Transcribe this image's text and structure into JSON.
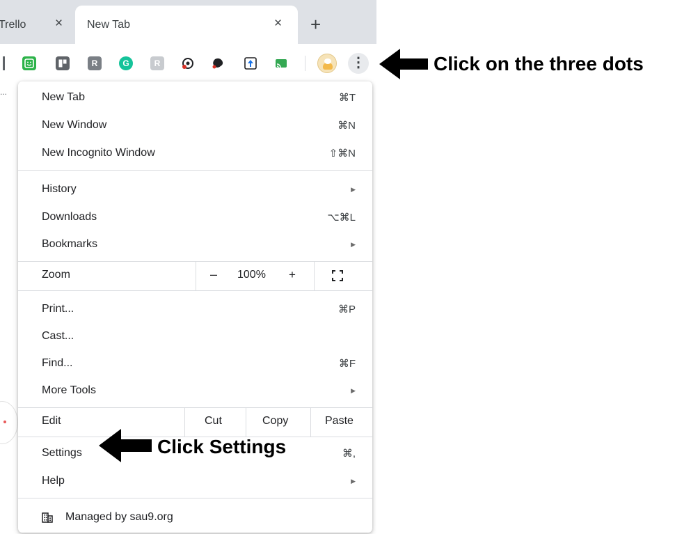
{
  "tabs": [
    {
      "title": "Trello",
      "close": "×"
    },
    {
      "title": "New Tab",
      "close": "×"
    }
  ],
  "new_tab_symbol": "+",
  "bookmark_stub": "...",
  "extensions": [
    {
      "icon": "smiley-extension-icon",
      "color": "#2db34a",
      "glyph": ""
    },
    {
      "icon": "trello-extension-icon",
      "color": "#5f6368",
      "glyph": ""
    },
    {
      "icon": "r-extension-icon",
      "color": "#7a7f85",
      "glyph": "R"
    },
    {
      "icon": "grammarly-icon",
      "color": "#15c39a",
      "glyph": "G"
    },
    {
      "icon": "r-script-extension-icon",
      "color": "#b9bcc0",
      "glyph": "R"
    },
    {
      "icon": "target-extension-icon",
      "color": "#202124",
      "glyph": ""
    },
    {
      "icon": "puzzle-extension-icon",
      "color": "#202124",
      "glyph": ""
    },
    {
      "icon": "upload-extension-icon",
      "color": "#1a73e8",
      "glyph": ""
    },
    {
      "icon": "cast-extension-icon",
      "color": "#34a853",
      "glyph": ""
    }
  ],
  "menu_button": {
    "glyph": "⋮"
  },
  "menu": {
    "new_tab": {
      "label": "New Tab",
      "shortcut": "⌘T"
    },
    "new_window": {
      "label": "New Window",
      "shortcut": "⌘N"
    },
    "new_incognito": {
      "label": "New Incognito Window",
      "shortcut": "⇧⌘N"
    },
    "history": {
      "label": "History",
      "arrow": "▶"
    },
    "downloads": {
      "label": "Downloads",
      "shortcut": "⌥⌘L"
    },
    "bookmarks": {
      "label": "Bookmarks",
      "arrow": "▶"
    },
    "zoom": {
      "label": "Zoom",
      "minus": "–",
      "value": "100%",
      "plus": "+"
    },
    "print": {
      "label": "Print...",
      "shortcut": "⌘P"
    },
    "cast": {
      "label": "Cast..."
    },
    "find": {
      "label": "Find...",
      "shortcut": "⌘F"
    },
    "more_tools": {
      "label": "More Tools",
      "arrow": "▶"
    },
    "edit": {
      "label": "Edit",
      "cut": "Cut",
      "copy": "Copy",
      "paste": "Paste"
    },
    "settings": {
      "label": "Settings",
      "shortcut": "⌘,"
    },
    "help": {
      "label": "Help",
      "arrow": "▶"
    },
    "managed": {
      "label": "Managed by sau9.org"
    }
  },
  "annotations": {
    "three_dots": "Click on the three dots",
    "settings": "Click Settings"
  }
}
